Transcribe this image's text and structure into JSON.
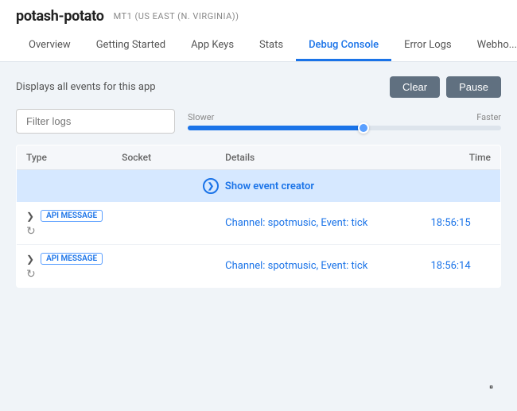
{
  "app": {
    "name": "potash-potato",
    "region": "MT1 (US EAST (N. VIRGINIA))"
  },
  "nav": {
    "tabs": [
      {
        "id": "overview",
        "label": "Overview",
        "active": false
      },
      {
        "id": "getting-started",
        "label": "Getting Started",
        "active": false
      },
      {
        "id": "app-keys",
        "label": "App Keys",
        "active": false
      },
      {
        "id": "stats",
        "label": "Stats",
        "active": false
      },
      {
        "id": "debug-console",
        "label": "Debug Console",
        "active": true
      },
      {
        "id": "error-logs",
        "label": "Error Logs",
        "active": false
      },
      {
        "id": "webhooks",
        "label": "Webho...",
        "active": false
      }
    ]
  },
  "toolbar": {
    "description": "Displays all events for this app",
    "clear_label": "Clear",
    "pause_label": "Pause"
  },
  "filter": {
    "placeholder": "Filter logs"
  },
  "speed": {
    "slower_label": "Slower",
    "faster_label": "Faster"
  },
  "table": {
    "headers": {
      "type": "Type",
      "socket": "Socket",
      "details": "Details",
      "time": "Time"
    },
    "show_event_label": "Show event creator",
    "rows": [
      {
        "badge": "API MESSAGE",
        "details": "Channel: spotmusic, Event: tick",
        "time": "18:56:15"
      },
      {
        "badge": "API MESSAGE",
        "details": "Channel: spotmusic, Event: tick",
        "time": "18:56:14"
      }
    ]
  }
}
